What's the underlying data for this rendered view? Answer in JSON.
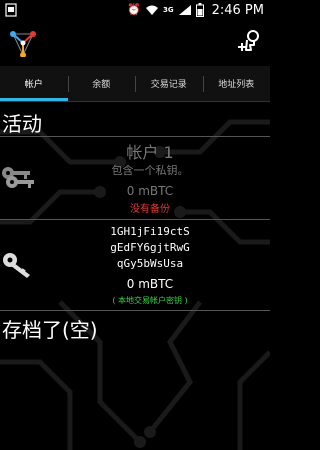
{
  "status_bar": {
    "network": "3G",
    "time": "2:46 PM"
  },
  "tabs": [
    {
      "label": "帐户"
    },
    {
      "label": "余额"
    },
    {
      "label": "交易记录"
    },
    {
      "label": "地址列表"
    }
  ],
  "active_section_title": "活动",
  "accounts": [
    {
      "name": "帐户 1",
      "description": "包含一个私钥。",
      "amount": "0 mBTC",
      "warning": "没有备份"
    },
    {
      "address_lines": [
        "1GH1jFi19ctS",
        "gEdFY6gjtRwG",
        "qGy5bWsUsa"
      ],
      "amount": "0 mBTC",
      "note": "( 本地交易帐户密钥 )"
    }
  ],
  "archived_section_title": "存档了(空)",
  "colors": {
    "accent": "#33b5e5",
    "warning": "#e53935",
    "note": "#3ad34a"
  }
}
